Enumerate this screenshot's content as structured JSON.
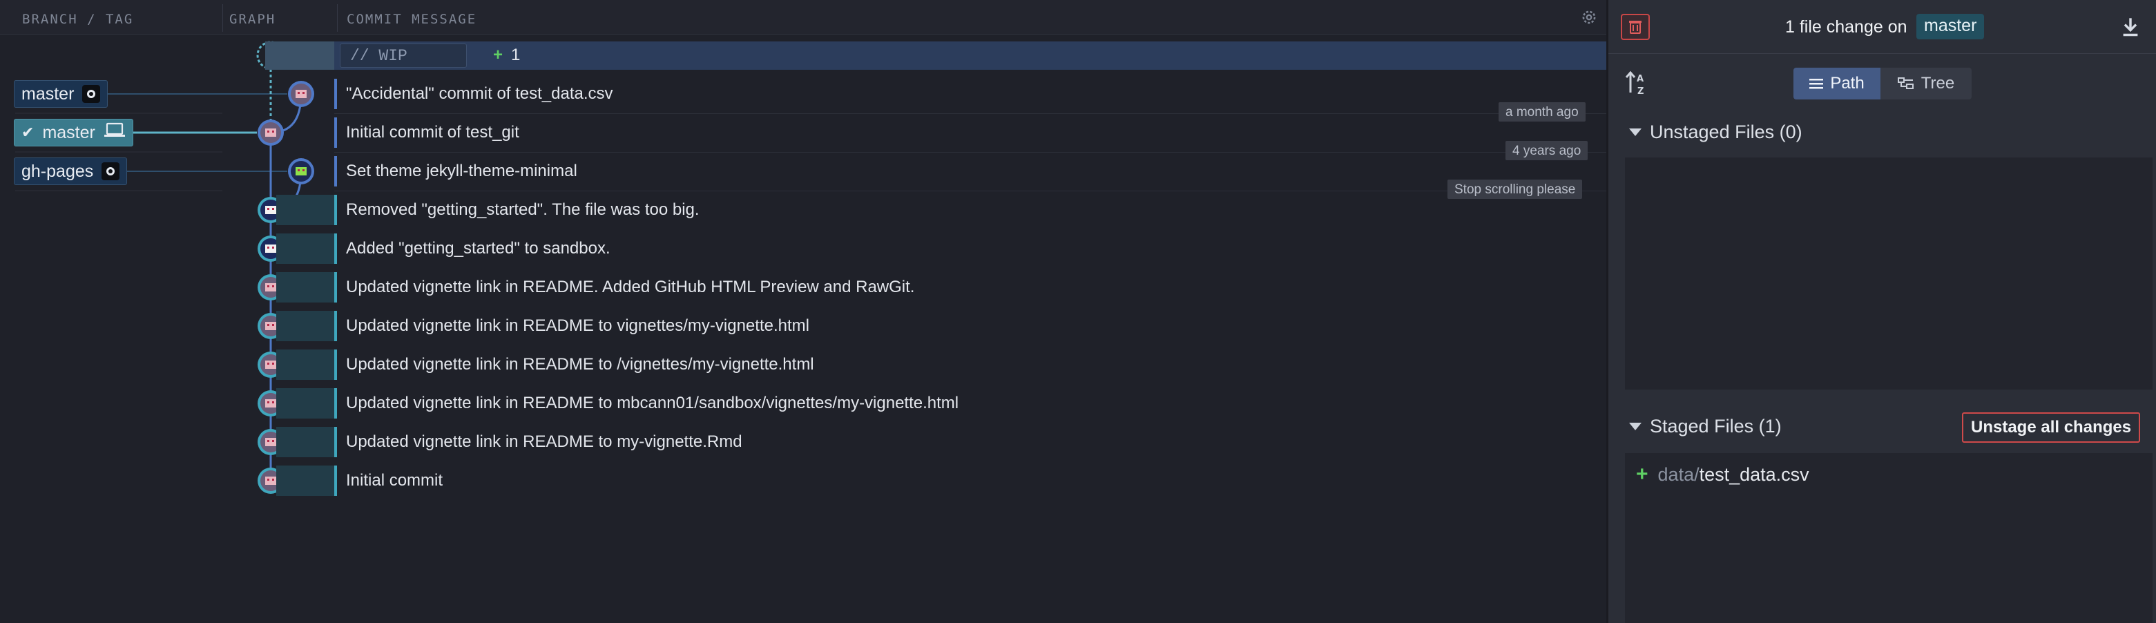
{
  "graph_header": {
    "branch_tag_label": "BRANCH / TAG",
    "graph_label": "GRAPH",
    "commit_message_label": "COMMIT MESSAGE",
    "settings_icon": "gear-icon"
  },
  "wip": {
    "placeholder": "// WIP",
    "count": "1"
  },
  "branches": [
    {
      "label": "master",
      "icon": "github-icon"
    },
    {
      "label": "master",
      "icon": "laptop-icon",
      "current": true
    },
    {
      "label": "gh-pages",
      "icon": "github-icon"
    }
  ],
  "commits": [
    {
      "message": "\"Accidental\" commit of test_data.csv"
    },
    {
      "message": "Initial commit of test_git"
    },
    {
      "message": "Set theme jekyll-theme-minimal"
    },
    {
      "message": "Removed \"getting_started\". The file was too big."
    },
    {
      "message": "Added \"getting_started\" to sandbox."
    },
    {
      "message": "Updated vignette link in README. Added GitHub HTML Preview and RawGit."
    },
    {
      "message": "Updated vignette link in README to vignettes/my-vignette.html"
    },
    {
      "message": "Updated vignette link in README to /vignettes/my-vignette.html"
    },
    {
      "message": "Updated vignette link in README to mbcann01/sandbox/vignettes/my-vignette.html"
    },
    {
      "message": "Updated vignette link in README to my-vignette.Rmd"
    },
    {
      "message": "Initial commit"
    }
  ],
  "tooltips": [
    "a month ago",
    "4 years ago",
    "Stop scrolling please"
  ],
  "stage": {
    "file_change_text": "1 file change on",
    "branch": "master",
    "view_path": "Path",
    "view_tree": "Tree",
    "unstaged_title": "Unstaged Files (0)",
    "staged_title": "Staged Files (1)",
    "unstage_all": "Unstage all changes",
    "staged_files": [
      {
        "dir": "data/",
        "name": "test_data.csv"
      }
    ]
  },
  "colors": {
    "accent_blue": "#4f79c7",
    "current_branch": "#3a7a8c",
    "danger": "#cf4a4a",
    "added": "#5fcf64"
  }
}
